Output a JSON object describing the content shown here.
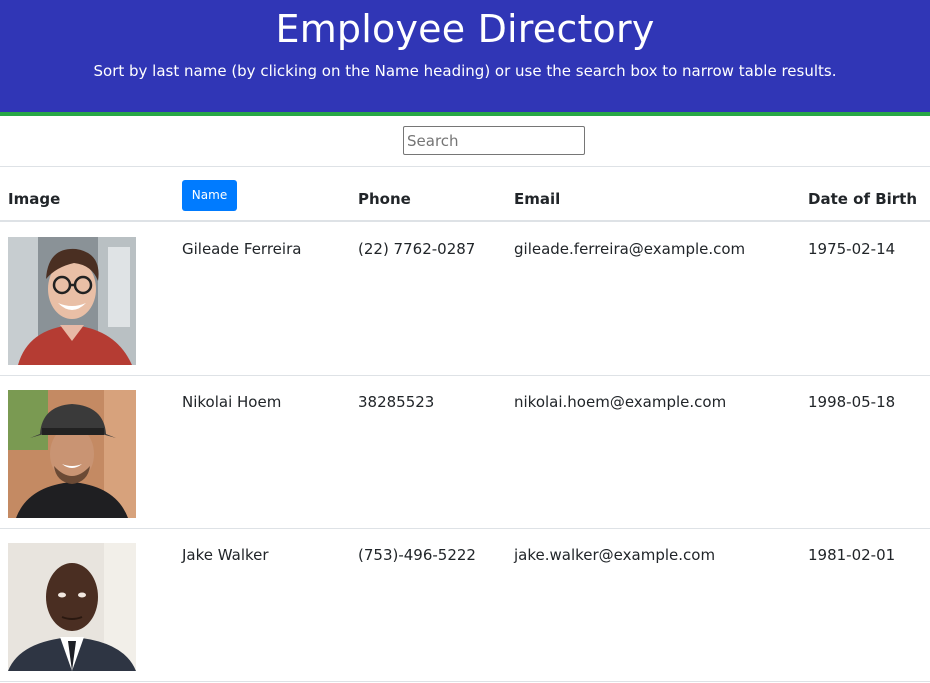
{
  "header": {
    "title": "Employee Directory",
    "subtitle": "Sort by last name (by clicking on the Name heading) or use the search box to narrow table results."
  },
  "search": {
    "placeholder": "Search",
    "value": ""
  },
  "table": {
    "columns": {
      "image": "Image",
      "name": "Name",
      "phone": "Phone",
      "email": "Email",
      "dob": "Date of Birth"
    },
    "rows": [
      {
        "name": "Gileade Ferreira",
        "phone": "(22) 7762-0287",
        "email": "gileade.ferreira@example.com",
        "dob": "1975-02-14"
      },
      {
        "name": "Nikolai Hoem",
        "phone": "38285523",
        "email": "nikolai.hoem@example.com",
        "dob": "1998-05-18"
      },
      {
        "name": "Jake Walker",
        "phone": "(753)-496-5222",
        "email": "jake.walker@example.com",
        "dob": "1981-02-01"
      }
    ]
  },
  "colors": {
    "header_bg": "#3036b6",
    "header_accent": "#28a745",
    "button_bg": "#007bff"
  }
}
